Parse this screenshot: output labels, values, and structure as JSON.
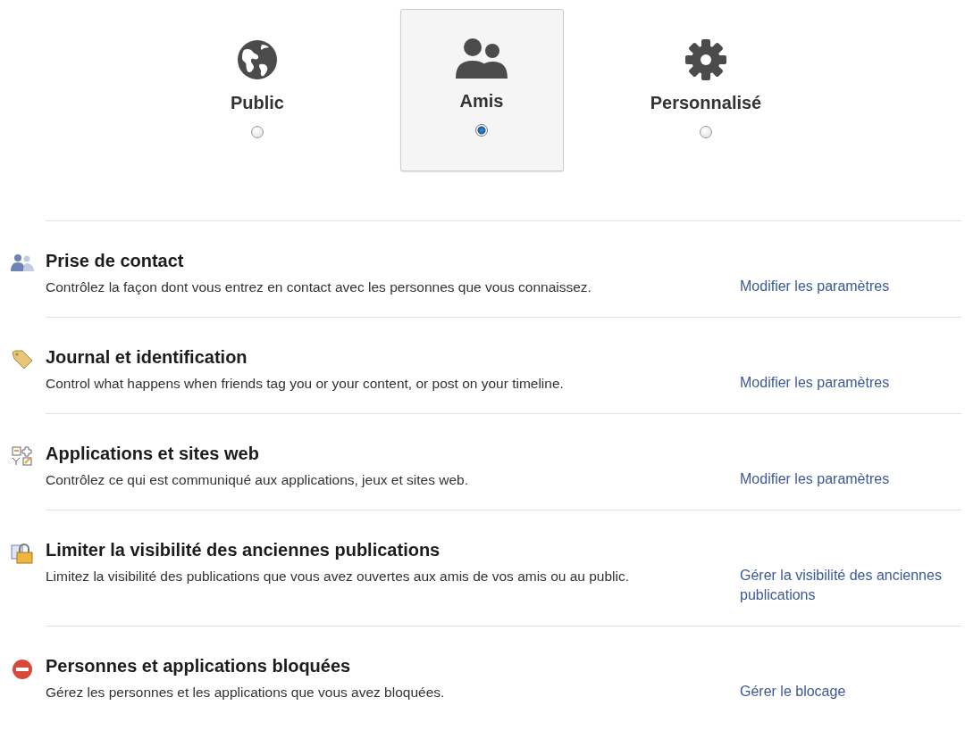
{
  "audience_options": [
    {
      "kind": "globe",
      "label": "Public",
      "selected": false
    },
    {
      "kind": "people",
      "label": "Amis",
      "selected": true
    },
    {
      "kind": "gear",
      "label": "Personnalisé",
      "selected": false
    }
  ],
  "sections": [
    {
      "kind": "people",
      "title": "Prise de contact",
      "description": "Contrôlez la façon dont vous entrez en contact avec les personnes que vous connaissez.",
      "link": "Modifier les paramètres"
    },
    {
      "kind": "tag",
      "title": "Journal et identification",
      "description": "Control what happens when friends tag you or your content, or post on your timeline.",
      "link": "Modifier les paramètres"
    },
    {
      "kind": "apps",
      "title": "Applications et sites web",
      "description": "Contrôlez ce qui est communiqué aux applications, jeux et sites web.",
      "link": "Modifier les paramètres"
    },
    {
      "kind": "lock",
      "title": "Limiter la visibilité des anciennes publications",
      "description": "Limitez la visibilité des publications que vous avez ouvertes aux amis de vos amis ou au public.",
      "link": "Gérer la visibilité des anciennes publications"
    },
    {
      "kind": "blocked",
      "title": "Personnes et applications bloquées",
      "description": "Gérez les personnes et les applications que vous avez bloquées.",
      "link": "Gérer le blocage"
    }
  ]
}
